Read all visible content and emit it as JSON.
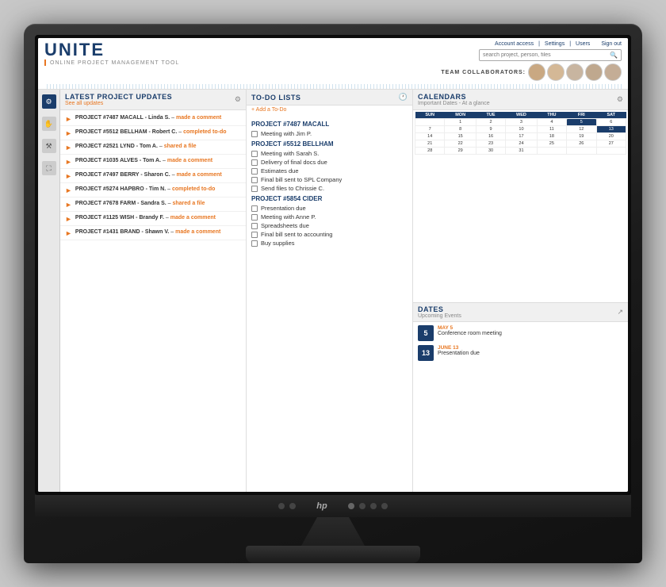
{
  "app": {
    "title": "UNITE",
    "subtitle": "ONLINE PROJECT MANAGEMENT TOOL",
    "signout": "Sign out",
    "header_links": [
      "Account access",
      "Settings",
      "Users"
    ],
    "search_placeholder": "search project, person, files",
    "team_label": "TEAM COLLABORATORS:"
  },
  "sidebar": {
    "icons": [
      "gear",
      "hand",
      "gear2",
      "monitor"
    ]
  },
  "updates": {
    "title": "LATEST PROJECT UPDATES",
    "see_all": "See all updates",
    "items": [
      {
        "project": "PROJECT #7487 MACALL - Linda S.",
        "action": "made a comment"
      },
      {
        "project": "PROJECT #5512 BELLHAM - Robert C.",
        "action": "completed to-do"
      },
      {
        "project": "PROJECT #2521 LYND - Tom A.",
        "action": "shared a file"
      },
      {
        "project": "PROJECT #1035 ALVES - Tom A.",
        "action": "made a comment"
      },
      {
        "project": "PROJECT #7497 BERRY - Sharon C.",
        "action": "made a comment"
      },
      {
        "project": "PROJECT #5274 HAPBRO - Tim N.",
        "action": "completed to-do"
      },
      {
        "project": "PROJECT #7678 FARM - Sandra S.",
        "action": "shared a file"
      },
      {
        "project": "PROJECT #1125 WISH - Brandy F.",
        "action": "made a comment"
      },
      {
        "project": "PROJECT #1431 BRAND - Shawn V.",
        "action": "made a comment"
      }
    ]
  },
  "todo": {
    "title": "TO-DO LISTS",
    "add_label": "+ Add a To-Do",
    "projects": [
      {
        "name": "PROJECT #7487 MACALL",
        "items": [
          "Meeting with Jim P."
        ]
      },
      {
        "name": "PROJECT #5512 BELLHAM",
        "items": [
          "Meeting with Sarah S.",
          "Delivery of final docs due",
          "Estimates due",
          "Final bill sent to SPL Company",
          "Send files to Chrissie C."
        ]
      },
      {
        "name": "PROJECT #5854 CIDER",
        "items": [
          "Presentation due",
          "Meeting with Anne P.",
          "Spreadsheets due",
          "Final bill sent to accounting",
          "Buy supplies"
        ]
      }
    ]
  },
  "calendars": {
    "title": "CALENDARS",
    "subtitle": "Important Dates - At a glance",
    "month_headers": [
      "SUN",
      "MON",
      "TUE",
      "WED",
      "THU",
      "FRI",
      "SAT"
    ],
    "weeks": [
      [
        "",
        "1",
        "2",
        "3",
        "4",
        "5",
        "6"
      ],
      [
        "7",
        "8",
        "9",
        "10",
        "11",
        "12",
        "13"
      ],
      [
        "14",
        "15",
        "16",
        "17",
        "18",
        "19",
        "20"
      ],
      [
        "21",
        "22",
        "23",
        "24",
        "25",
        "26",
        "27"
      ],
      [
        "28",
        "29",
        "30",
        "31",
        "",
        "",
        ""
      ]
    ]
  },
  "dates": {
    "title": "DATES",
    "subtitle": "Upcoming Events",
    "items": [
      {
        "day": "5",
        "month": "MAY 5",
        "desc": "Conference room meeting"
      },
      {
        "day": "13",
        "month": "JUNE 13",
        "desc": "Presentation due"
      }
    ]
  }
}
